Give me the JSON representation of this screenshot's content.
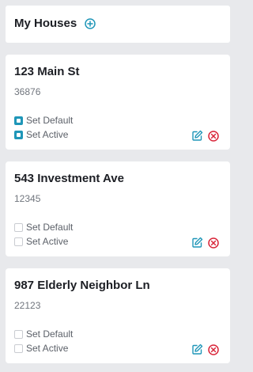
{
  "header": {
    "title": "My Houses",
    "add_icon": "plus-circle-icon"
  },
  "colors": {
    "accent": "#1f96b8",
    "danger": "#d9263a",
    "background": "#e8e9ec"
  },
  "houses": [
    {
      "address": "123 Main St",
      "zip": "36876",
      "default_label": "Set Default",
      "default_checked": true,
      "active_label": "Set Active",
      "active_checked": true,
      "edit_icon": "edit-icon",
      "remove_icon": "remove-icon"
    },
    {
      "address": "543 Investment Ave",
      "zip": "12345",
      "default_label": "Set Default",
      "default_checked": false,
      "active_label": "Set Active",
      "active_checked": false,
      "edit_icon": "edit-icon",
      "remove_icon": "remove-icon"
    },
    {
      "address": "987 Elderly Neighbor Ln",
      "zip": "22123",
      "default_label": "Set Default",
      "default_checked": false,
      "active_label": "Set Active",
      "active_checked": false,
      "edit_icon": "edit-icon",
      "remove_icon": "remove-icon"
    }
  ]
}
